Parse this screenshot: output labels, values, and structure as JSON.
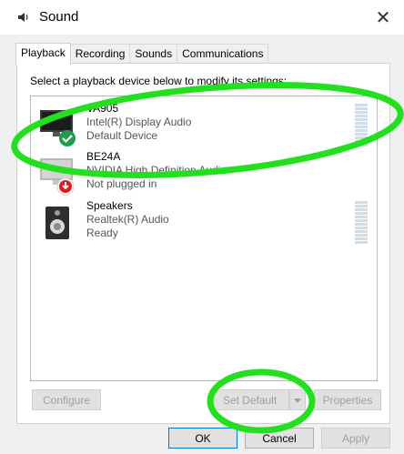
{
  "window": {
    "title": "Sound",
    "close_glyph": "✕"
  },
  "tabs": [
    {
      "label": "Playback",
      "active": true
    },
    {
      "label": "Recording",
      "active": false
    },
    {
      "label": "Sounds",
      "active": false
    },
    {
      "label": "Communications",
      "active": false
    }
  ],
  "instruction": "Select a playback device below to modify its settings:",
  "devices": [
    {
      "name": "VA905",
      "driver": "Intel(R) Display Audio",
      "status": "Default Device",
      "icon": "monitor-icon",
      "badge": "check-badge-icon",
      "meter": true
    },
    {
      "name": "BE24A",
      "driver": "NVIDIA High Definition Audio",
      "status": "Not plugged in",
      "icon": "monitor-icon",
      "badge": "unplugged-badge-icon",
      "meter": false
    },
    {
      "name": "Speakers",
      "driver": "Realtek(R) Audio",
      "status": "Ready",
      "icon": "speaker-icon",
      "badge": "",
      "meter": true
    }
  ],
  "buttons": {
    "configure": "Configure",
    "set_default": "Set Default",
    "properties": "Properties",
    "ok": "OK",
    "cancel": "Cancel",
    "apply": "Apply"
  },
  "colors": {
    "highlight": "#22e01e",
    "accent": "#0078d7",
    "check": "#1f9e4a",
    "unplugged": "#d42020"
  }
}
